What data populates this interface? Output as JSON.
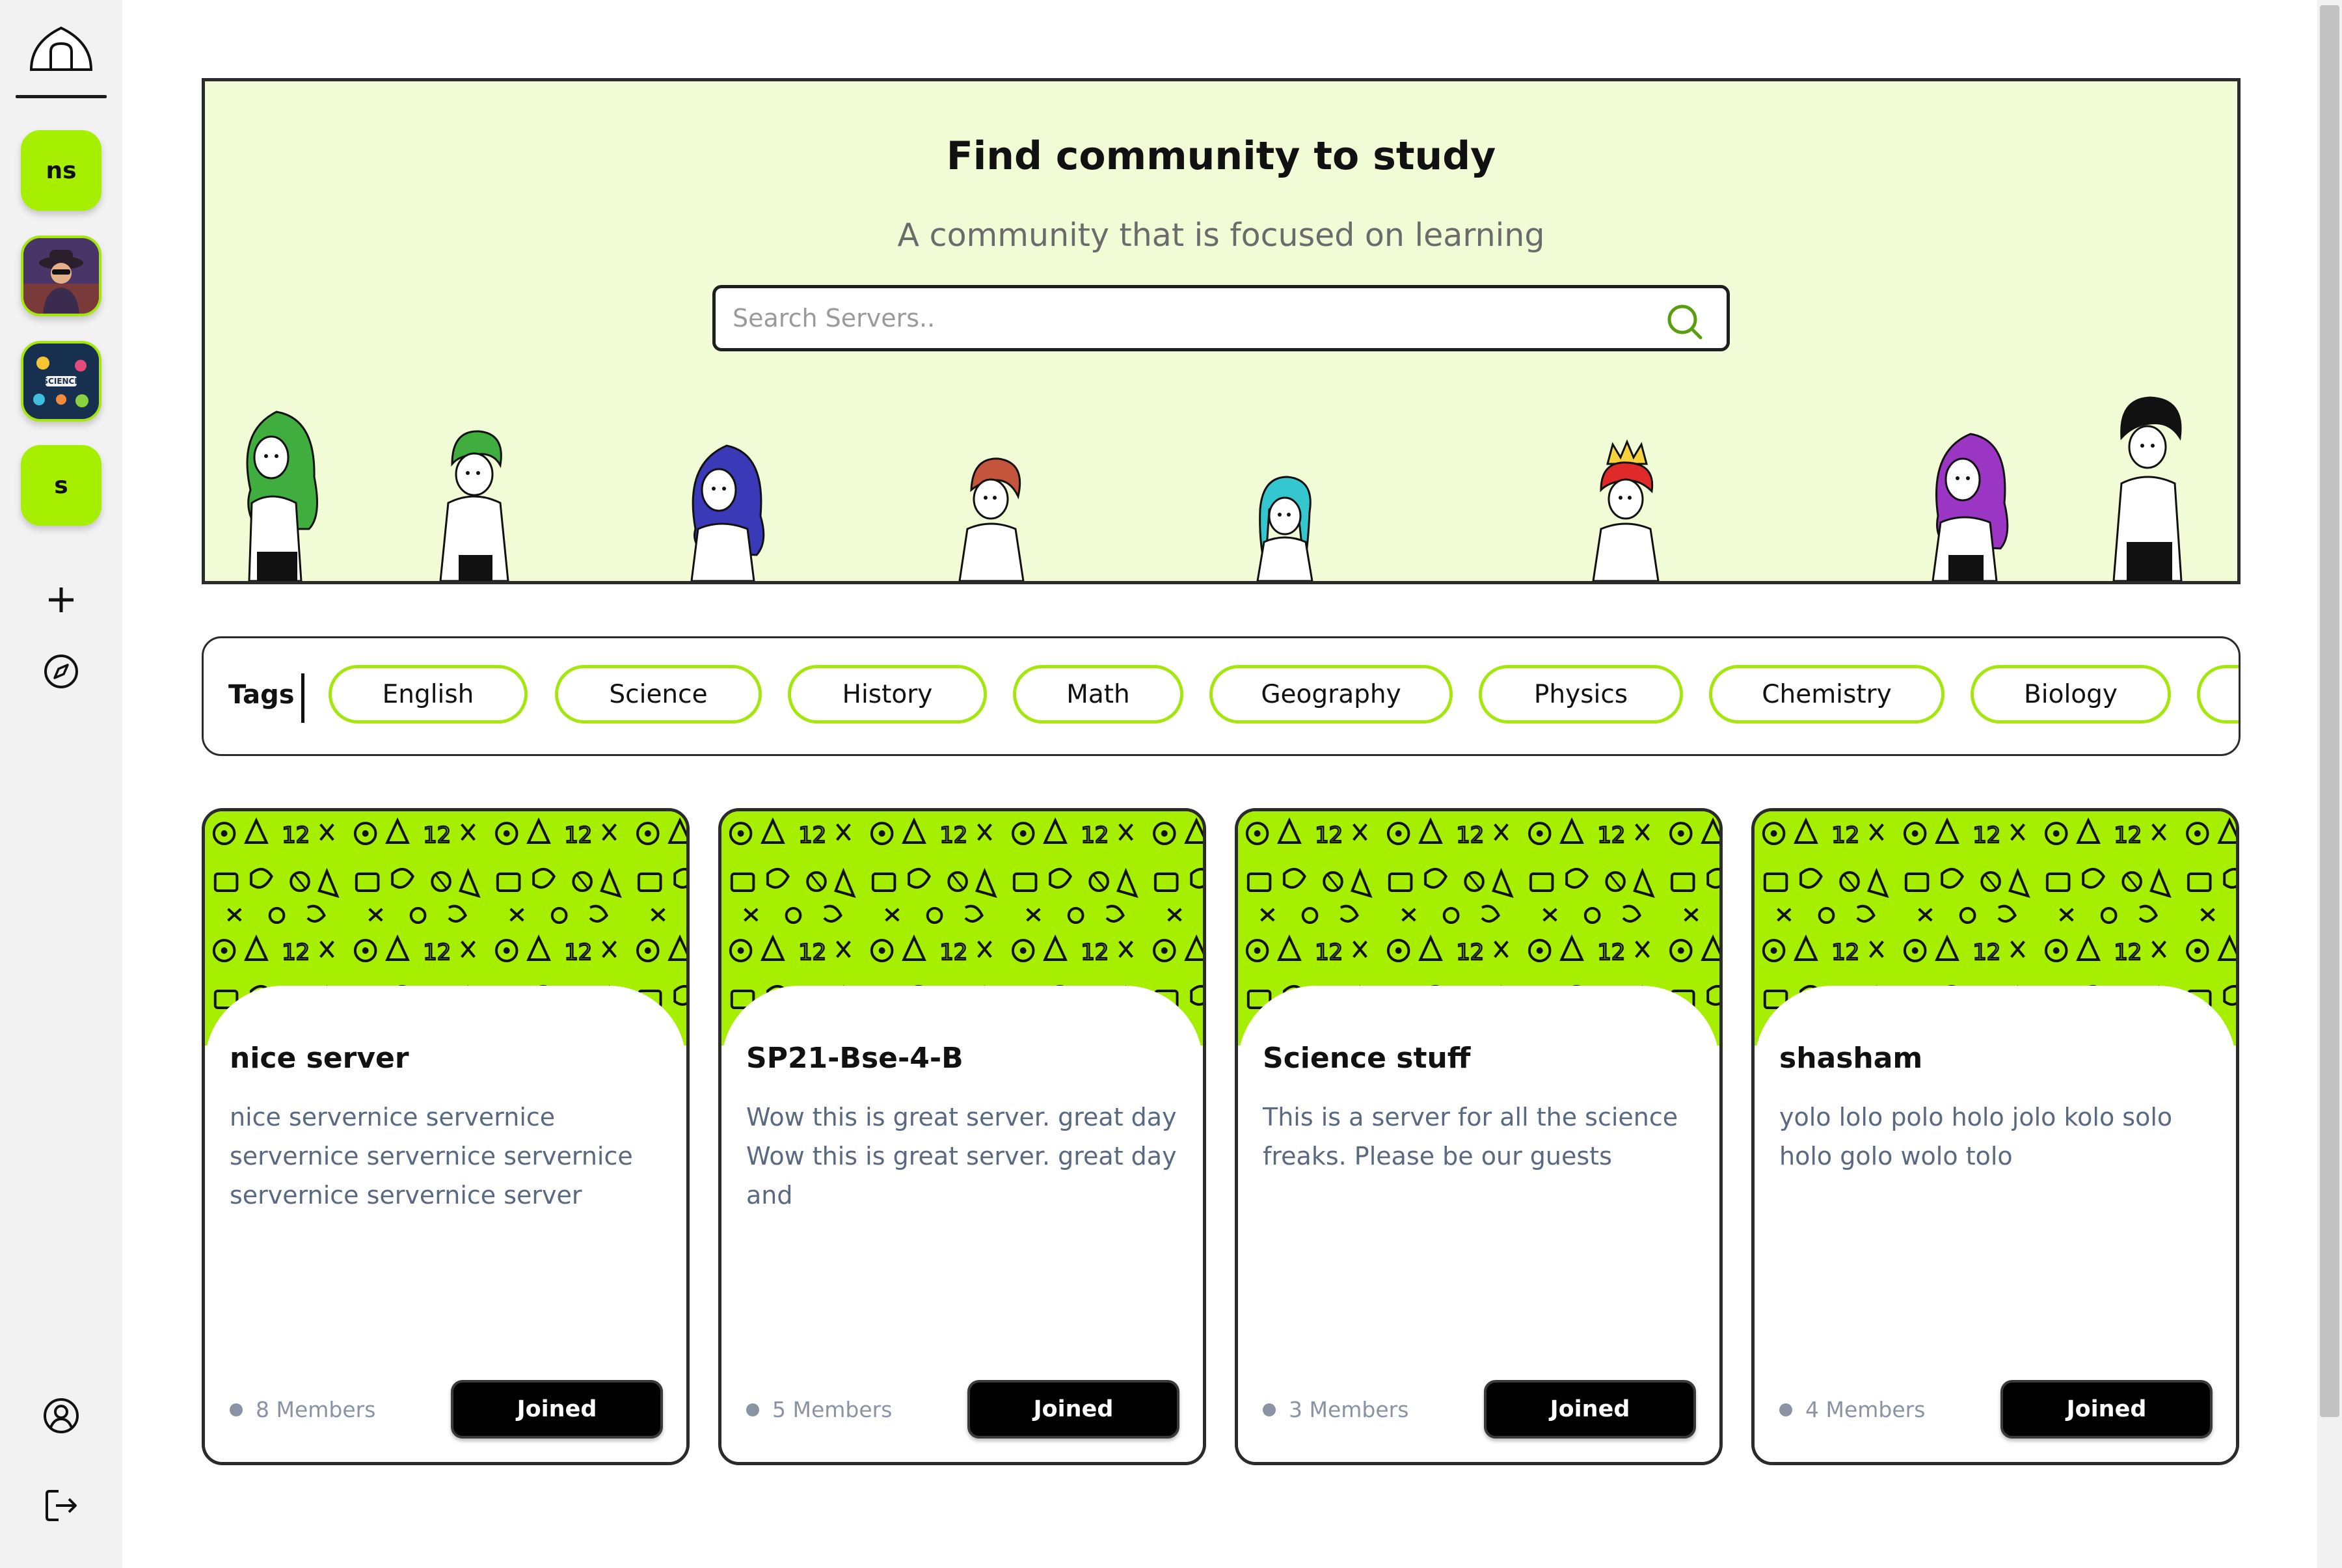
{
  "sidebar": {
    "servers": [
      {
        "label": "ns"
      },
      {
        "label": ""
      },
      {
        "label": ""
      },
      {
        "label": "s"
      }
    ]
  },
  "hero": {
    "title": "Find community to study",
    "subtitle": "A community that is focused on learning",
    "search_placeholder": "Search Servers.."
  },
  "tags": {
    "label": "Tags",
    "items": [
      "English",
      "Science",
      "History",
      "Math",
      "Geography",
      "Physics",
      "Chemistry",
      "Biology"
    ]
  },
  "cards": [
    {
      "title": "nice server",
      "description": "nice servernice servernice servernice servernice servernice servernice servernice server",
      "members": "8 Members",
      "button": "Joined"
    },
    {
      "title": "SP21-Bse-4-B",
      "description": "Wow this is great server. great day Wow this is great server. great day and",
      "members": "5 Members",
      "button": "Joined"
    },
    {
      "title": "Science stuff",
      "description": "This is a server for all the science freaks. Please be our guests",
      "members": "3 Members",
      "button": "Joined"
    },
    {
      "title": "shasham",
      "description": "yolo lolo polo holo jolo kolo solo holo golo wolo tolo",
      "members": "4 Members",
      "button": "Joined"
    }
  ],
  "colors": {
    "accent": "#a6ef00",
    "hero_bg": "#f1fcd6",
    "dark": "#000000"
  }
}
